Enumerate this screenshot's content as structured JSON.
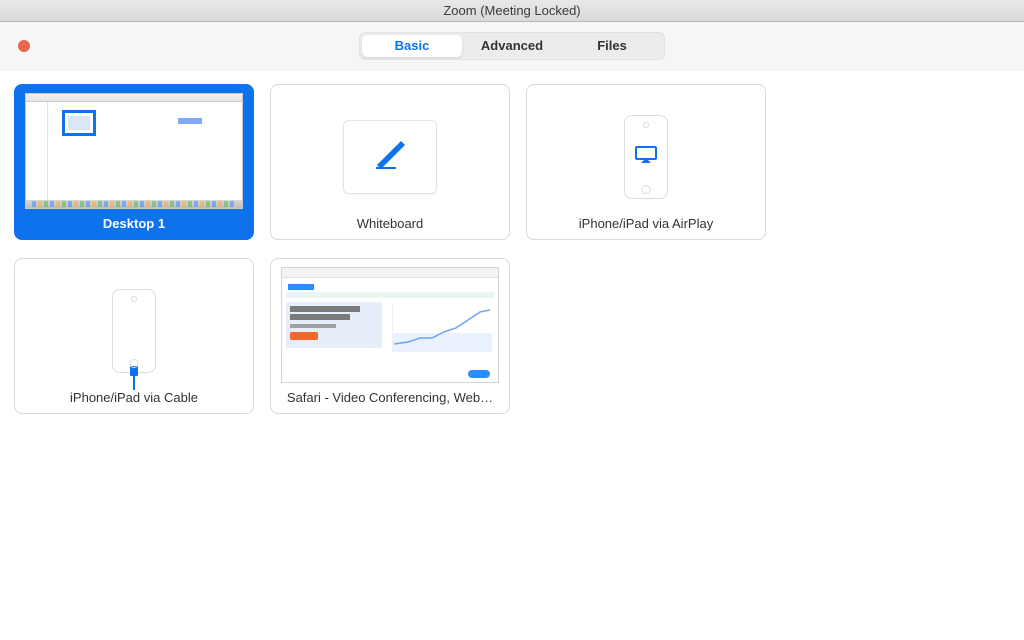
{
  "titlebar": {
    "title": "Zoom (Meeting Locked)"
  },
  "tabs": {
    "basic": "Basic",
    "advanced": "Advanced",
    "files": "Files",
    "active": "basic"
  },
  "options": {
    "desktop1": {
      "label": "Desktop 1"
    },
    "whiteboard": {
      "label": "Whiteboard"
    },
    "airplay": {
      "label": "iPhone/iPad via AirPlay"
    },
    "cable": {
      "label": "iPhone/iPad via Cable"
    },
    "safari": {
      "label": "Safari - Video Conferencing, Web…"
    }
  },
  "icons": {
    "marker": "marker-icon",
    "airplay": "airplay-icon",
    "cable": "cable-icon"
  },
  "colors": {
    "accent": "#0e72ed"
  }
}
